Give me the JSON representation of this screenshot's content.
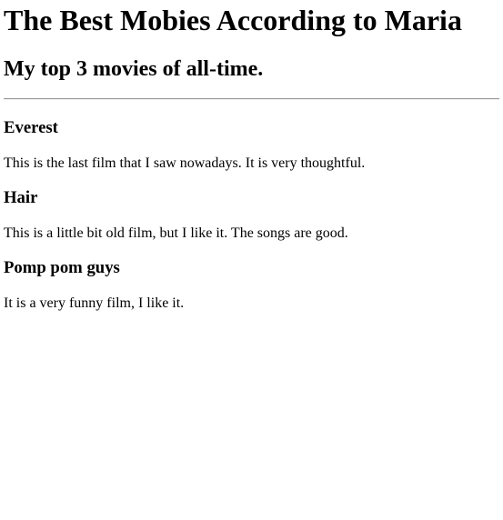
{
  "page": {
    "title": "The Best Mobies According to Maria",
    "subtitle": "My top 3 movies of all-time."
  },
  "movies": [
    {
      "name": "Everest",
      "description": "This is the last film that I saw nowadays. It is very thoughtful."
    },
    {
      "name": "Hair",
      "description": "This is a little bit old film, but I like it. The songs are good."
    },
    {
      "name": "Pomp pom guys",
      "description": "It is a very funny film, I like it."
    }
  ]
}
